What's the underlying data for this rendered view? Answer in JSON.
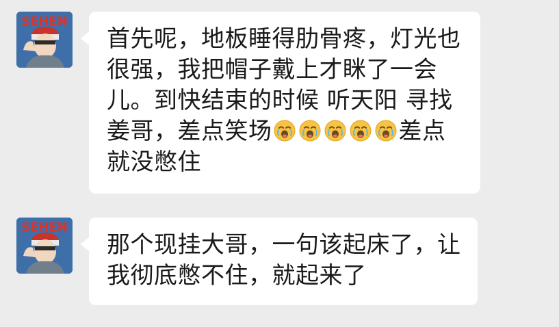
{
  "chat": {
    "messages": [
      {
        "avatar_icon": "anime-character-avatar",
        "avatar_text": "SEHEN",
        "lines": [
          "首先呢，地板睡得肋骨疼，灯光也",
          "很强，我把帽子戴上才眯了一会",
          "儿。到快结束的时候 听天阳 寻找",
          "姜哥，差点笑场",
          "就没憋住"
        ],
        "line4_after_emoji": "差点",
        "emoji_count": 5,
        "emoji_icon": "crying-laughing-face-icon"
      },
      {
        "avatar_icon": "anime-character-avatar",
        "avatar_text": "SEHEN",
        "lines": [
          "那个现挂大哥，一句该起床了，让",
          "我彻底憋不住，就起来了"
        ]
      }
    ]
  },
  "colors": {
    "background": "#ececec",
    "bubble": "#ffffff",
    "text": "#1a1a1a",
    "avatar_bg": "#3f6fa8",
    "avatar_text": "#d9342b"
  }
}
